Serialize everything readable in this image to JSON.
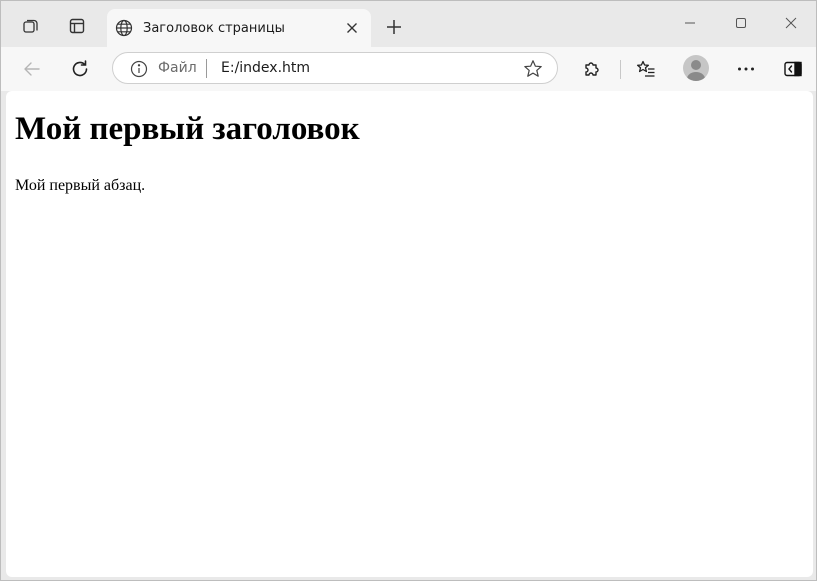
{
  "browser": {
    "tab": {
      "title": "Заголовок страницы",
      "favicon": "globe-icon"
    },
    "address_bar": {
      "scheme_label": "Файл",
      "url": "E:/index.htm"
    },
    "icons": {
      "workspaces": "workspaces-icon",
      "tab_actions": "tab-actions-icon",
      "back": "back-arrow-icon",
      "refresh": "refresh-icon",
      "info": "info-icon",
      "favorite": "star-icon",
      "extensions": "puzzle-icon",
      "favorites": "favorites-list-icon",
      "profile": "profile-avatar",
      "more": "more-dots-icon",
      "sidebar": "sidebar-toggle-icon",
      "new_tab": "plus-icon",
      "close_tab": "close-icon",
      "minimize": "minimize-icon",
      "maximize": "maximize-icon",
      "close_window": "close-window-icon"
    }
  },
  "page": {
    "heading": "Мой первый заголовок",
    "paragraph": "Мой первый абзац."
  },
  "colors": {
    "chrome_background": "#e9e9e9",
    "toolbar_background": "#f7f7f7",
    "page_background": "#ffffff"
  }
}
